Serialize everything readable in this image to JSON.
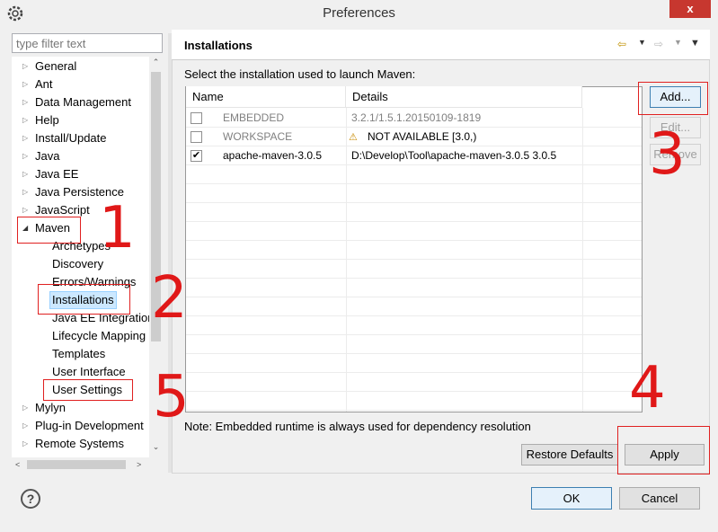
{
  "window": {
    "title": "Preferences",
    "close_label": "x"
  },
  "filter": {
    "placeholder": "type filter text"
  },
  "tree": {
    "items": [
      {
        "label": "General"
      },
      {
        "label": "Ant"
      },
      {
        "label": "Data Management"
      },
      {
        "label": "Help"
      },
      {
        "label": "Install/Update"
      },
      {
        "label": "Java"
      },
      {
        "label": "Java EE"
      },
      {
        "label": "Java Persistence"
      },
      {
        "label": "JavaScript"
      },
      {
        "label": "Maven"
      },
      {
        "label": "Archetypes"
      },
      {
        "label": "Discovery"
      },
      {
        "label": "Errors/Warnings"
      },
      {
        "label": "Installations"
      },
      {
        "label": "Java EE Integration"
      },
      {
        "label": "Lifecycle Mapping"
      },
      {
        "label": "Templates"
      },
      {
        "label": "User Interface"
      },
      {
        "label": "User Settings"
      },
      {
        "label": "Mylyn"
      },
      {
        "label": "Plug-in Development"
      },
      {
        "label": "Remote Systems"
      }
    ]
  },
  "panel": {
    "title": "Installations",
    "select_label": "Select the installation used to launch Maven:",
    "columns": [
      "Name",
      "Details"
    ],
    "rows": [
      {
        "name": "EMBEDDED",
        "details": "3.2.1/1.5.1.20150109-1819",
        "checked": false
      },
      {
        "name": "WORKSPACE",
        "details": "NOT AVAILABLE [3.0,)",
        "checked": false
      },
      {
        "name": "apache-maven-3.0.5",
        "details": "D:\\Develop\\Tool\\apache-maven-3.0.5 3.0.5",
        "checked": true
      }
    ],
    "buttons": {
      "add": "Add...",
      "edit": "Edit...",
      "remove": "Remove"
    },
    "note": "Note: Embedded runtime is always used for dependency resolution",
    "restore_defaults": "Restore Defaults",
    "apply": "Apply"
  },
  "footer": {
    "ok": "OK",
    "cancel": "Cancel"
  },
  "annotations": [
    "1",
    "2",
    "3",
    "4",
    "5"
  ],
  "colors": {
    "annotation": "#e01818",
    "selection": "#cce8ff",
    "close": "#c7372f"
  }
}
